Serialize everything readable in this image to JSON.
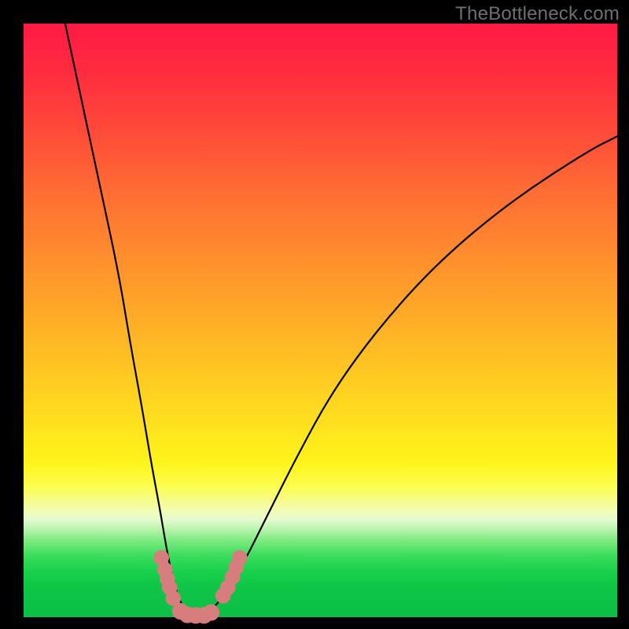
{
  "watermark": "TheBottleneck.com",
  "chart_data": {
    "type": "line",
    "title": "",
    "xlabel": "",
    "ylabel": "",
    "xlim": [
      0,
      100
    ],
    "ylim": [
      0,
      100
    ],
    "series": [
      {
        "name": "bottleneck-curve",
        "x": [
          7,
          10,
          13,
          16,
          18,
          20,
          21.5,
          23,
          24,
          25,
          26,
          27,
          28.5,
          30,
          32,
          34,
          37,
          41,
          46,
          52,
          60,
          70,
          82,
          95,
          100
        ],
        "values": [
          100,
          86,
          72,
          58,
          46,
          35,
          26,
          18,
          12,
          7,
          3.5,
          1.5,
          0.5,
          0.5,
          1.5,
          4,
          9,
          17,
          27,
          38,
          49,
          60,
          70,
          78.5,
          81
        ]
      }
    ],
    "markers": {
      "name": "bottleneck-markers",
      "color": "#d77d7d",
      "points": [
        {
          "x": 23.2,
          "y": 10.0,
          "r": 1.3
        },
        {
          "x": 23.8,
          "y": 8.0,
          "r": 1.3
        },
        {
          "x": 24.2,
          "y": 6.5,
          "r": 1.3
        },
        {
          "x": 24.6,
          "y": 5.0,
          "r": 1.3
        },
        {
          "x": 25.2,
          "y": 3.2,
          "r": 1.3
        },
        {
          "x": 26.4,
          "y": 1.0,
          "r": 1.4
        },
        {
          "x": 27.6,
          "y": 0.4,
          "r": 1.4
        },
        {
          "x": 29.0,
          "y": 0.3,
          "r": 1.4
        },
        {
          "x": 30.4,
          "y": 0.3,
          "r": 1.4
        },
        {
          "x": 31.6,
          "y": 0.8,
          "r": 1.4
        },
        {
          "x": 33.6,
          "y": 3.6,
          "r": 1.3
        },
        {
          "x": 34.4,
          "y": 5.0,
          "r": 1.3
        },
        {
          "x": 35.2,
          "y": 6.8,
          "r": 1.3
        },
        {
          "x": 35.8,
          "y": 8.4,
          "r": 1.3
        },
        {
          "x": 36.4,
          "y": 10.0,
          "r": 1.3
        }
      ]
    }
  }
}
